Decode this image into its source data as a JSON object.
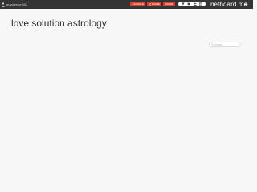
{
  "topbar": {
    "username": "guypierson003",
    "share_buttons": [
      {
        "label": "GOOGLE",
        "icon": "google-plus-icon"
      },
      {
        "label": "SHARE",
        "icon": "share-icon"
      },
      {
        "label": "SHARE",
        "icon": "share-icon"
      }
    ],
    "tools": [
      "filter-icon",
      "tag-icon",
      "people-icon",
      "layout-icon"
    ],
    "brand": "netboard.me",
    "logout_icon": "logout-icon"
  },
  "main": {
    "title": "love solution astrology"
  },
  "search": {
    "placeholder": "search",
    "value": ""
  },
  "colors": {
    "topbar": "#323436",
    "share_button": "#d8412f",
    "background": "#f7f7f7"
  }
}
